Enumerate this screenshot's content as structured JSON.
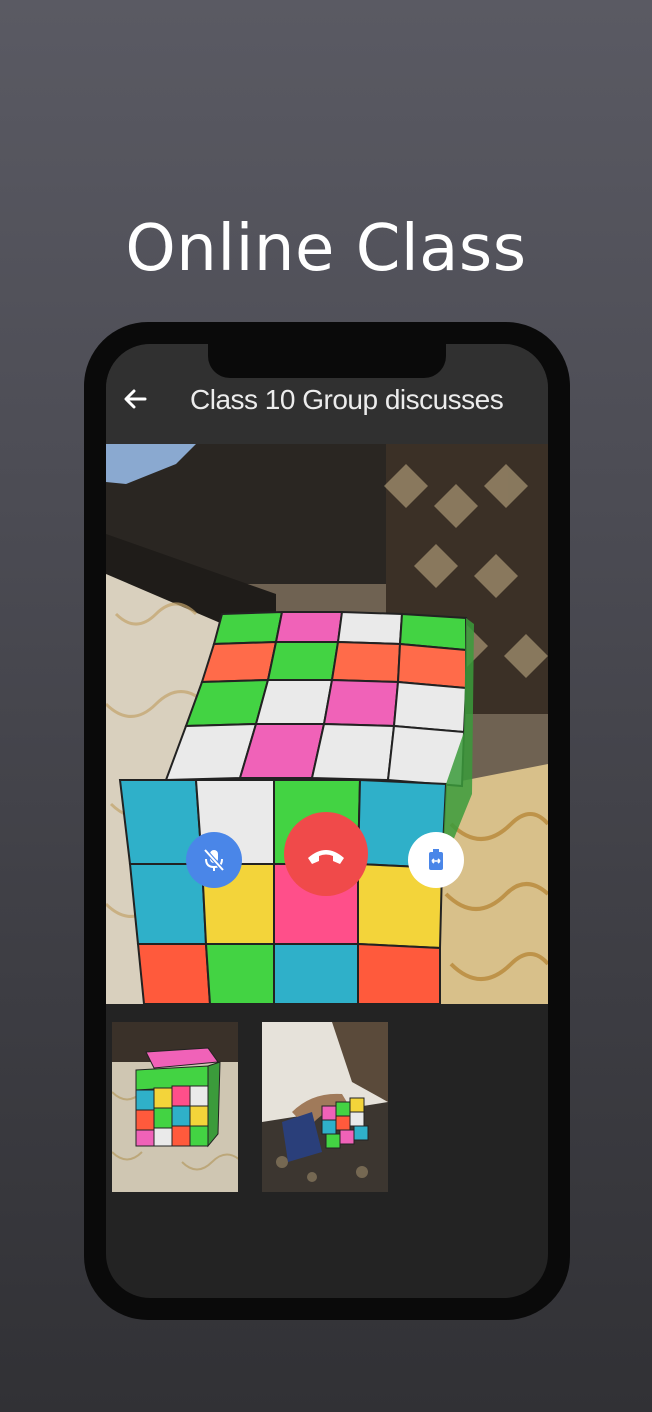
{
  "promo": {
    "headline": "Online Class"
  },
  "app_bar": {
    "back_icon": "arrow-back-icon",
    "title": "Class 10 Group discusses"
  },
  "call": {
    "main_video": "remote-participant-video",
    "controls": [
      {
        "name": "mute-microphone",
        "icon": "mic-off-icon",
        "color": "#4a86e8"
      },
      {
        "name": "end-call",
        "icon": "phone-hangup-icon",
        "color": "#f04a4a"
      },
      {
        "name": "switch-camera",
        "icon": "switch-camera-icon",
        "color": "#ffffff"
      }
    ],
    "participant_thumbnails": [
      {
        "name": "participant-1"
      },
      {
        "name": "participant-2"
      }
    ]
  },
  "colors": {
    "app_bar": "#303030",
    "screen_bg": "#232323",
    "accent_blue": "#4a86e8",
    "danger_red": "#f04a4a"
  }
}
